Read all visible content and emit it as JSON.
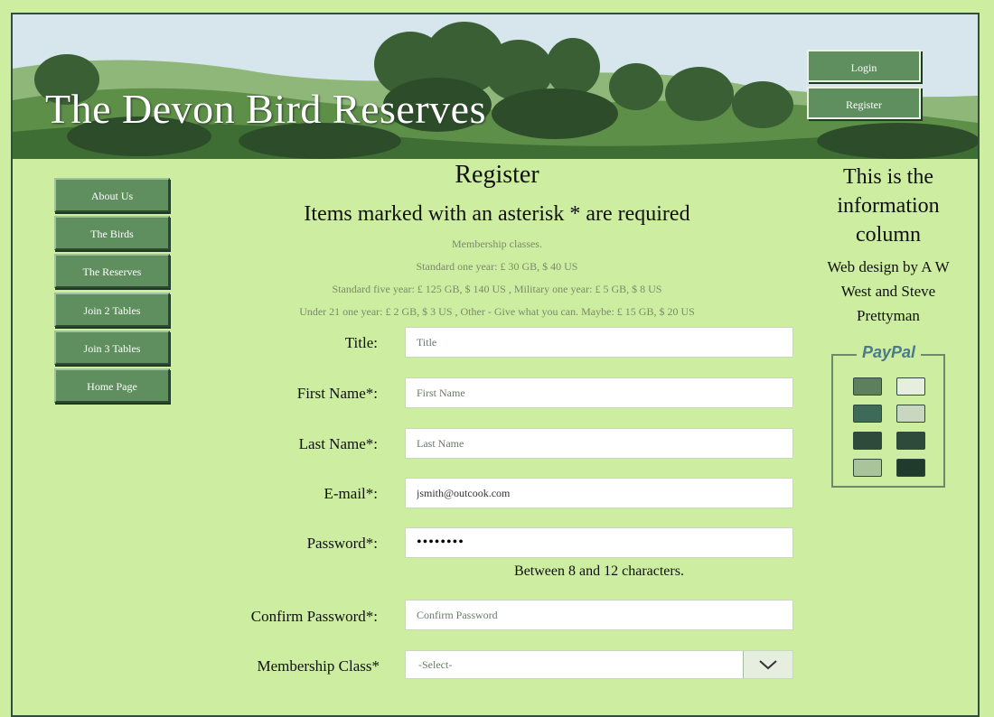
{
  "header": {
    "site_title": "The Devon Bird Reserves",
    "login_label": "Login",
    "register_label": "Register"
  },
  "nav": {
    "items": [
      "About Us",
      "The Birds",
      "The Reserves",
      "Join 2 Tables",
      "Join 3 Tables",
      "Home Page"
    ]
  },
  "main": {
    "heading": "Register",
    "subheading": "Items marked with an asterisk * are required",
    "membership_lines": [
      "Membership classes.",
      "Standard one year: £ 30 GB, $ 40 US",
      "Standard five year: £ 125 GB, $ 140 US , Military one year: £ 5 GB, $ 8 US",
      "Under 21 one year: £ 2 GB, $ 3 US , Other - Give what you can. Maybe: £ 15 GB, $ 20 US"
    ],
    "fields": {
      "title": {
        "label": "Title:",
        "placeholder": "Title",
        "value": ""
      },
      "first_name": {
        "label": "First Name*:",
        "placeholder": "First Name",
        "value": ""
      },
      "last_name": {
        "label": "Last Name*:",
        "placeholder": "Last Name",
        "value": ""
      },
      "email": {
        "label": "E-mail*:",
        "placeholder": "",
        "value": "jsmith@outcook.com"
      },
      "password": {
        "label": "Password*:",
        "placeholder": "",
        "value": "••••••••"
      },
      "confirm_password": {
        "label": "Confirm Password*:",
        "placeholder": "Confirm Password",
        "value": ""
      }
    },
    "password_hint": "Between 8 and 12 characters.",
    "membership_class": {
      "label": "Membership Class*",
      "selected": "-Select-"
    }
  },
  "info_column": {
    "title": "This is the information column",
    "credit": "Web design by A W West and Steve Prettyman",
    "paypal_logo": "PayPal"
  },
  "colors": {
    "page_bg": "#cdeea0",
    "button_bg": "#5f8f5f",
    "frame_border": "#2f4f3a"
  }
}
